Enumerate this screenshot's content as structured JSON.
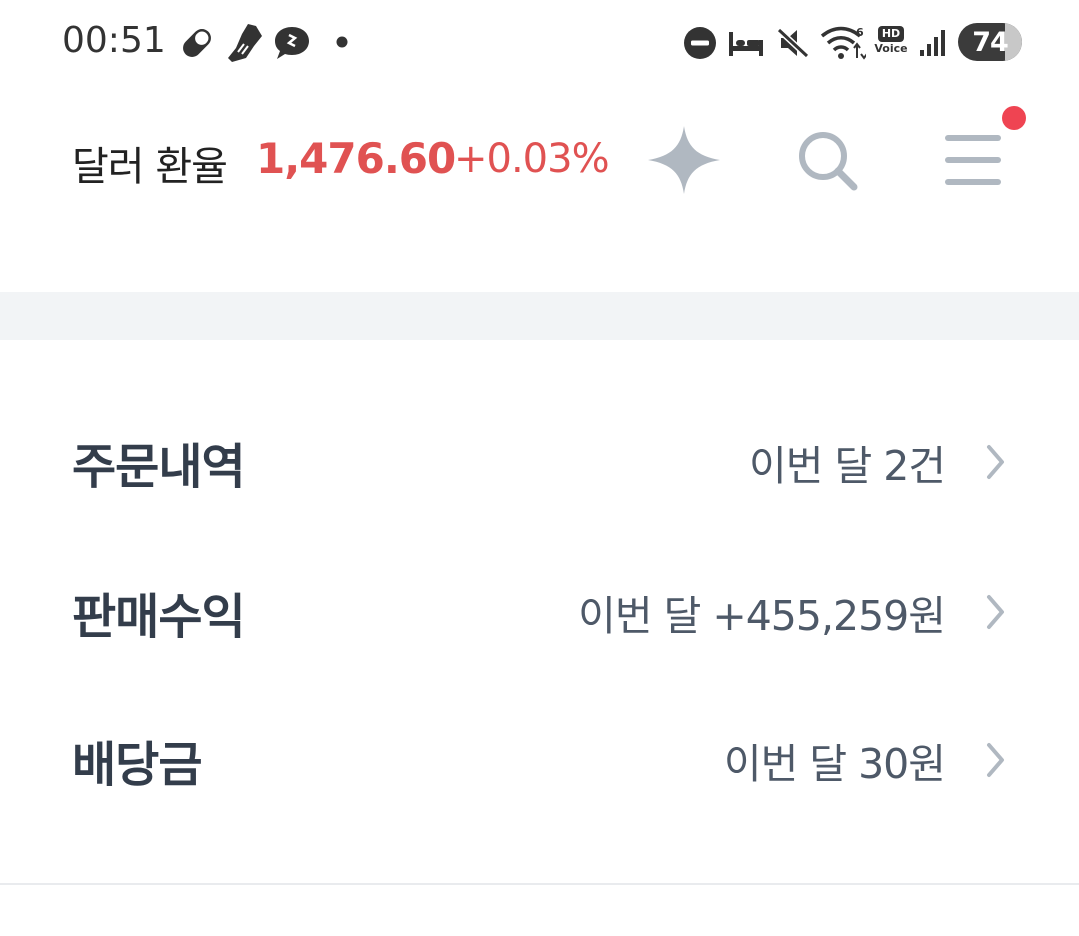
{
  "status_bar": {
    "time": "00:51",
    "battery": "74",
    "battery_fraction": 0.74,
    "left_icons": [
      "pill-icon",
      "shoe-icon",
      "chat-bubble-icon",
      "dot-icon"
    ],
    "right_icons": [
      "do-not-disturb-icon",
      "bed-icon",
      "mute-icon",
      "wifi-icon",
      "hd-voice-icon",
      "signal-icon",
      "battery-icon"
    ],
    "hd_voice_top": "HD",
    "hd_voice_bottom": "Voice",
    "wifi_badge": "6"
  },
  "header": {
    "rate_label": "달러 환율",
    "rate_value": "1,476.60",
    "rate_change": "+0.03%",
    "icons": [
      "sparkle-icon",
      "search-icon",
      "menu-icon"
    ],
    "accent_color": "#e05252",
    "notification_color": "#ef4452"
  },
  "summary_list": [
    {
      "title": "주문내역",
      "value": "이번 달 2건"
    },
    {
      "title": "판매수익",
      "value": "이번 달 +455,259원"
    },
    {
      "title": "배당금",
      "value": "이번 달 30원"
    }
  ],
  "colors": {
    "section_gap": "#f2f4f6",
    "title_text": "#333d4b",
    "value_text": "#4e5968",
    "icon_gray": "#b0b8c1"
  }
}
